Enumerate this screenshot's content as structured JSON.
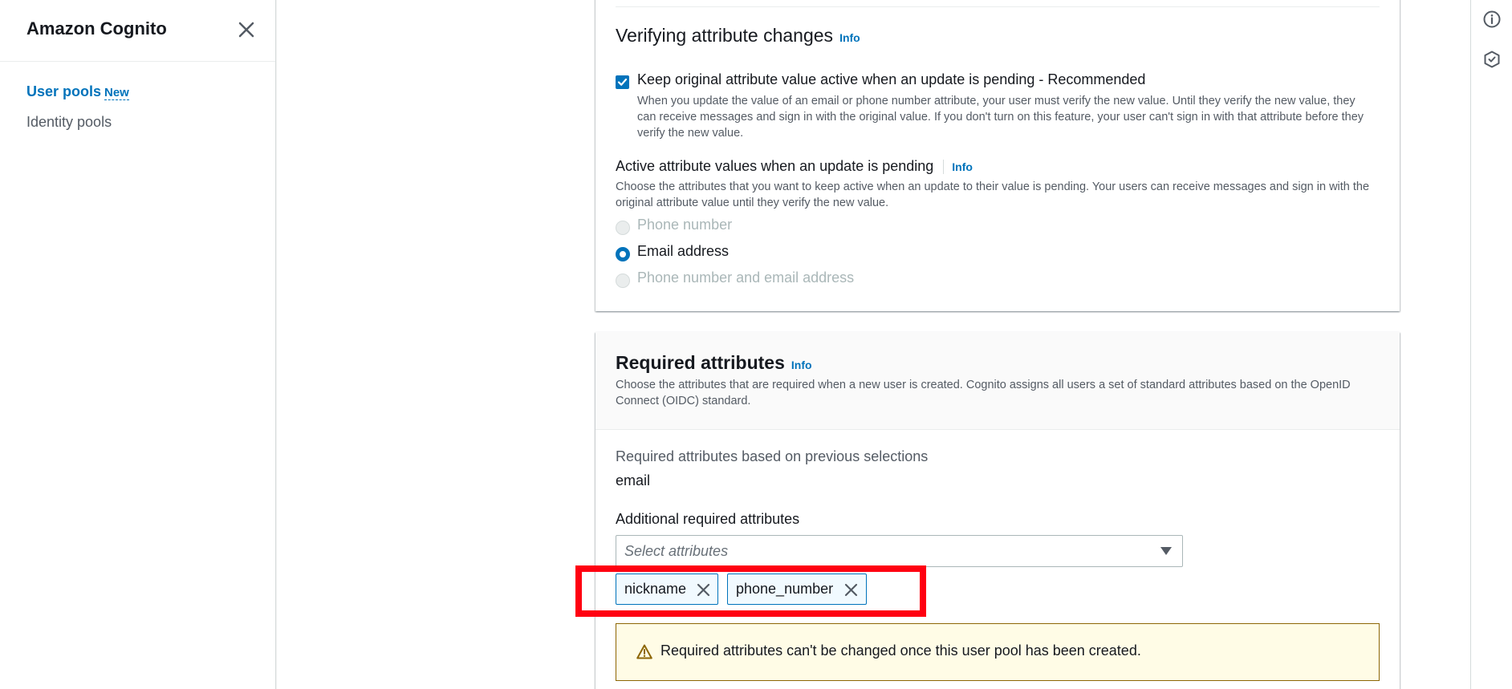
{
  "sidebar": {
    "title": "Amazon Cognito",
    "items": [
      {
        "label": "User pools",
        "badge": "New"
      },
      {
        "label": "Identity pools"
      }
    ]
  },
  "verifying": {
    "title": "Verifying attribute changes",
    "info": "Info",
    "checkbox_label": "Keep original attribute value active when an update is pending - Recommended",
    "checkbox_checked": true,
    "checkbox_desc": "When you update the value of an email or phone number attribute, your user must verify the new value. Until they verify the new value, they can receive messages and sign in with the original value. If you don't turn on this feature, your user can't sign in with that attribute before they verify the new value.",
    "active_title": "Active attribute values when an update is pending",
    "active_info": "Info",
    "active_desc": "Choose the attributes that you want to keep active when an update to their value is pending. Your users can receive messages and sign in with the original attribute value until they verify the new value.",
    "options": [
      {
        "label": "Phone number",
        "state": "disabled"
      },
      {
        "label": "Email address",
        "state": "selected"
      },
      {
        "label": "Phone number and email address",
        "state": "disabled"
      }
    ]
  },
  "required": {
    "title": "Required attributes",
    "info": "Info",
    "desc": "Choose the attributes that are required when a new user is created. Cognito assigns all users a set of standard attributes based on the OpenID Connect (OIDC) standard.",
    "previous_label": "Required attributes based on previous selections",
    "previous_value": "email",
    "additional_label": "Additional required attributes",
    "select_placeholder": "Select attributes",
    "tokens": [
      "nickname",
      "phone_number"
    ],
    "warning": "Required attributes can't be changed once this user pool has been created."
  },
  "colors": {
    "accent": "#0073bb",
    "highlight": "#ff0011",
    "warning_border": "#8d6605"
  }
}
